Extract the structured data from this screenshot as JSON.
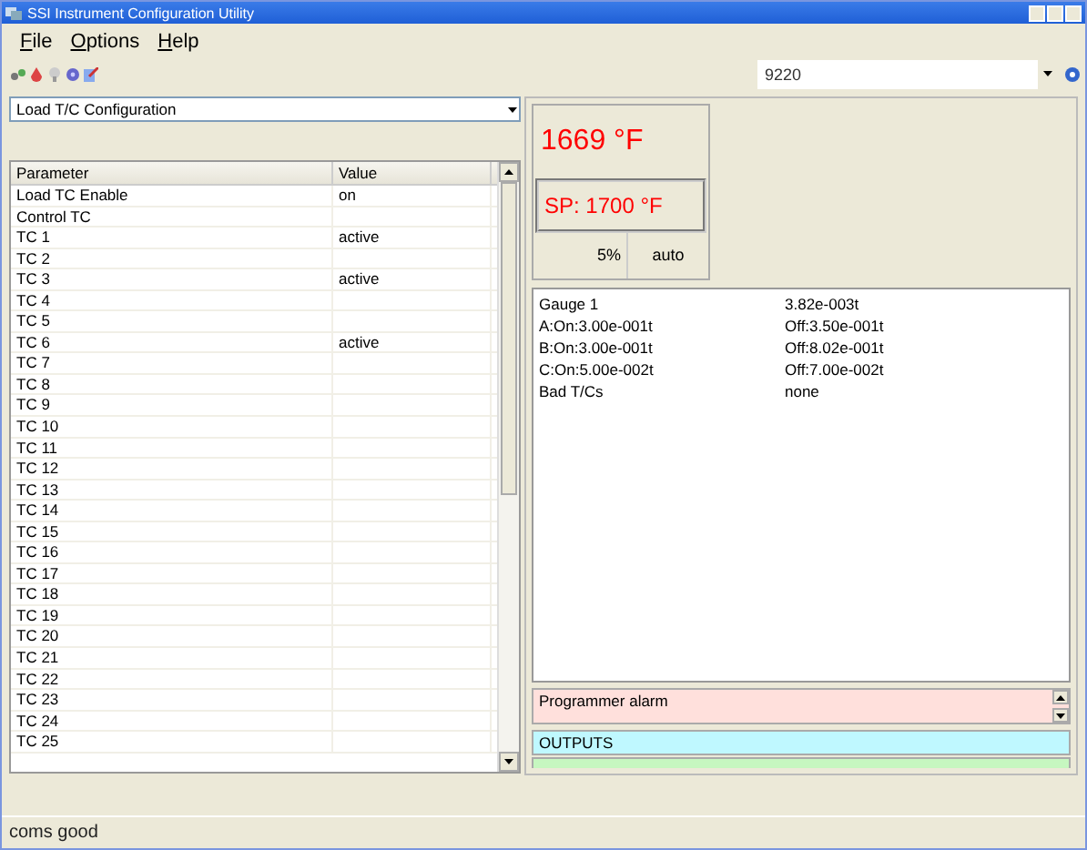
{
  "window": {
    "title": "SSI Instrument Configuration Utility"
  },
  "menu": [
    "File",
    "Options",
    "Help"
  ],
  "device_select": {
    "value": "9220"
  },
  "config_select": {
    "value": "Load T/C Configuration"
  },
  "table": {
    "columns": [
      "Parameter",
      "Value"
    ],
    "rows": [
      {
        "parameter": "Load TC Enable",
        "value": "on"
      },
      {
        "parameter": "Control TC",
        "value": ""
      },
      {
        "parameter": "TC 1",
        "value": "active"
      },
      {
        "parameter": "TC 2",
        "value": ""
      },
      {
        "parameter": "TC 3",
        "value": "active"
      },
      {
        "parameter": "TC 4",
        "value": ""
      },
      {
        "parameter": "TC 5",
        "value": ""
      },
      {
        "parameter": "TC 6",
        "value": "active"
      },
      {
        "parameter": "TC 7",
        "value": ""
      },
      {
        "parameter": "TC 8",
        "value": ""
      },
      {
        "parameter": "TC 9",
        "value": ""
      },
      {
        "parameter": "TC 10",
        "value": ""
      },
      {
        "parameter": "TC 11",
        "value": ""
      },
      {
        "parameter": "TC 12",
        "value": ""
      },
      {
        "parameter": "TC 13",
        "value": ""
      },
      {
        "parameter": "TC 14",
        "value": ""
      },
      {
        "parameter": "TC 15",
        "value": ""
      },
      {
        "parameter": "TC 16",
        "value": ""
      },
      {
        "parameter": "TC 17",
        "value": ""
      },
      {
        "parameter": "TC 18",
        "value": ""
      },
      {
        "parameter": "TC 19",
        "value": ""
      },
      {
        "parameter": "TC 20",
        "value": ""
      },
      {
        "parameter": "TC 21",
        "value": ""
      },
      {
        "parameter": "TC 22",
        "value": ""
      },
      {
        "parameter": "TC 23",
        "value": ""
      },
      {
        "parameter": "TC 24",
        "value": ""
      },
      {
        "parameter": "TC 25",
        "value": ""
      }
    ]
  },
  "display": {
    "process_value": "1669 °F",
    "setpoint": "SP: 1700 °F",
    "output": "5%",
    "mode": "auto"
  },
  "gauge": [
    {
      "label": "Gauge 1",
      "value": "3.82e-003t"
    },
    {
      "label": "A:On:3.00e-001t",
      "value": "Off:3.50e-001t"
    },
    {
      "label": "B:On:3.00e-001t",
      "value": "Off:8.02e-001t"
    },
    {
      "label": "C:On:5.00e-002t",
      "value": "Off:7.00e-002t"
    },
    {
      "label": "Bad T/Cs",
      "value": "none"
    }
  ],
  "alarms": [
    "Programmer alarm"
  ],
  "outputs": {
    "label": "OUTPUTS"
  },
  "status_bar": "coms good"
}
